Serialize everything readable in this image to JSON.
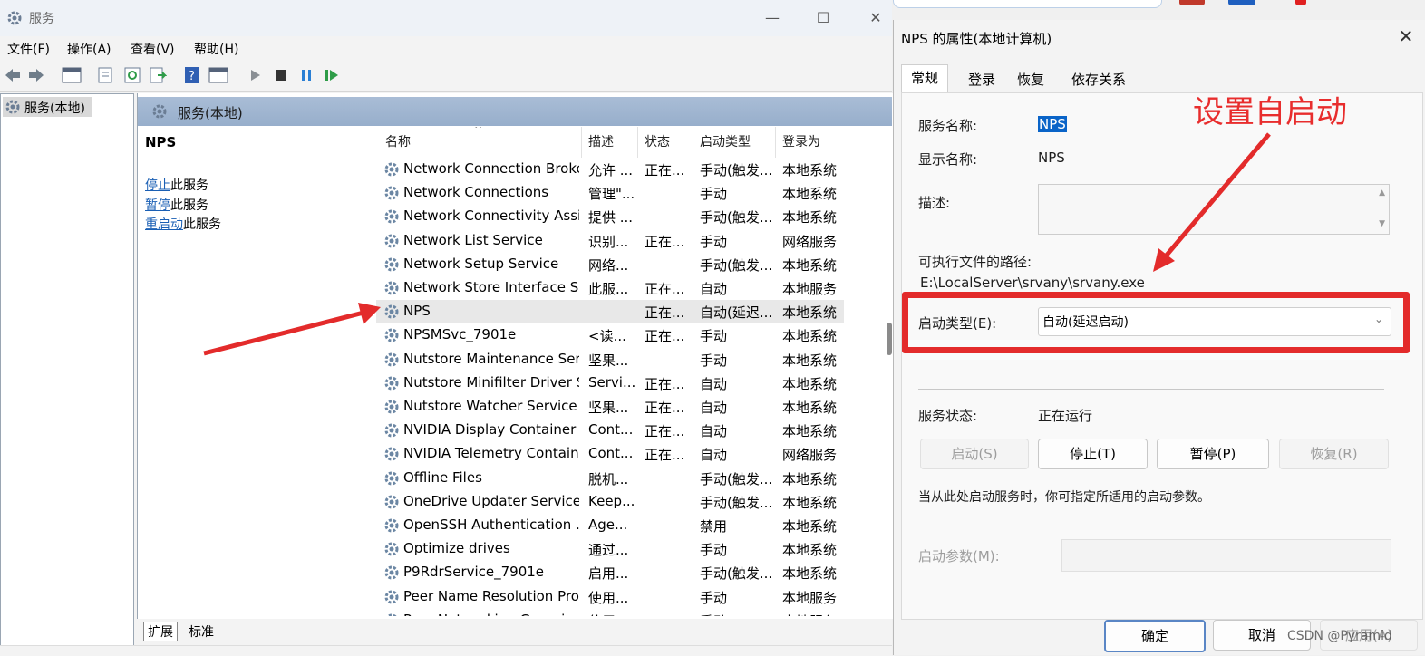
{
  "main": {
    "title": "服务",
    "menus": [
      "文件(F)",
      "操作(A)",
      "查看(V)",
      "帮助(H)"
    ],
    "tree_item": "服务(本地)",
    "pane_title": "服务(本地)",
    "selected_name": "NPS",
    "actions": [
      {
        "link": "停止",
        "rest": "此服务"
      },
      {
        "link": "暂停",
        "rest": "此服务"
      },
      {
        "link": "重启动",
        "rest": "此服务"
      }
    ],
    "columns": [
      "名称",
      "描述",
      "状态",
      "启动类型",
      "登录为"
    ],
    "rows": [
      [
        "Network Connection Broker",
        "允许 ...",
        "正在...",
        "手动(触发...",
        "本地系统"
      ],
      [
        "Network Connections",
        "管理\"...",
        "",
        "手动",
        "本地系统"
      ],
      [
        "Network Connectivity Assis...",
        "提供 ...",
        "",
        "手动(触发...",
        "本地系统"
      ],
      [
        "Network List Service",
        "识别...",
        "正在...",
        "手动",
        "网络服务"
      ],
      [
        "Network Setup Service",
        "网络...",
        "",
        "手动(触发...",
        "本地系统"
      ],
      [
        "Network Store Interface Se...",
        "此服...",
        "正在...",
        "自动",
        "本地服务"
      ],
      [
        "NPS",
        "",
        "正在...",
        "自动(延迟...",
        "本地系统"
      ],
      [
        "NPSMSvc_7901e",
        "<读...",
        "正在...",
        "手动",
        "本地系统"
      ],
      [
        "Nutstore Maintenance Ser...",
        "坚果...",
        "",
        "手动",
        "本地系统"
      ],
      [
        "Nutstore Minifilter Driver S...",
        "Servi...",
        "正在...",
        "自动",
        "本地系统"
      ],
      [
        "Nutstore Watcher Service",
        "坚果...",
        "正在...",
        "自动",
        "本地系统"
      ],
      [
        "NVIDIA Display Container LS",
        "Cont...",
        "正在...",
        "自动",
        "本地系统"
      ],
      [
        "NVIDIA Telemetry Container",
        "Cont...",
        "正在...",
        "自动",
        "网络服务"
      ],
      [
        "Offline Files",
        "脱机...",
        "",
        "手动(触发...",
        "本地系统"
      ],
      [
        "OneDrive Updater Service",
        "Keep...",
        "",
        "手动(触发...",
        "本地系统"
      ],
      [
        "OpenSSH Authentication ...",
        "Age...",
        "",
        "禁用",
        "本地系统"
      ],
      [
        "Optimize drives",
        "通过...",
        "",
        "手动",
        "本地系统"
      ],
      [
        "P9RdrService_7901e",
        "启用...",
        "",
        "手动(触发...",
        "本地系统"
      ],
      [
        "Peer Name Resolution Pro...",
        "使用...",
        "",
        "手动",
        "本地服务"
      ],
      [
        "Peer Networking Grouping",
        "使用...",
        "",
        "手动",
        "本地服务"
      ]
    ],
    "bottom_tabs": [
      "扩展",
      "标准"
    ]
  },
  "dialog": {
    "title": "NPS 的属性(本地计算机)",
    "tabs": [
      "常规",
      "登录",
      "恢复",
      "依存关系"
    ],
    "service_name_label": "服务名称:",
    "service_name": "NPS",
    "display_name_label": "显示名称:",
    "display_name": "NPS",
    "desc_label": "描述:",
    "path_label": "可执行文件的路径:",
    "path": "E:\\LocalServer\\srvany\\srvany.exe",
    "startup_type_label": "启动类型(E):",
    "startup_type": "自动(延迟启动)",
    "status_label": "服务状态:",
    "status": "正在运行",
    "buttons": {
      "start": "启动(S)",
      "stop": "停止(T)",
      "pause": "暂停(P)",
      "resume": "恢复(R)"
    },
    "hint": "当从此处启动服务时，你可指定所适用的启动参数。",
    "params_label": "启动参数(M):",
    "ok": "确定",
    "cancel": "取消",
    "apply": "应用(A)"
  },
  "annotation": "设置自启动",
  "watermark": "CSDN @Pyramid",
  "colors": {
    "annotation_red": "#e32b2b",
    "link_blue": "#1a5fb4",
    "header_blue": "#a9bdd6"
  }
}
